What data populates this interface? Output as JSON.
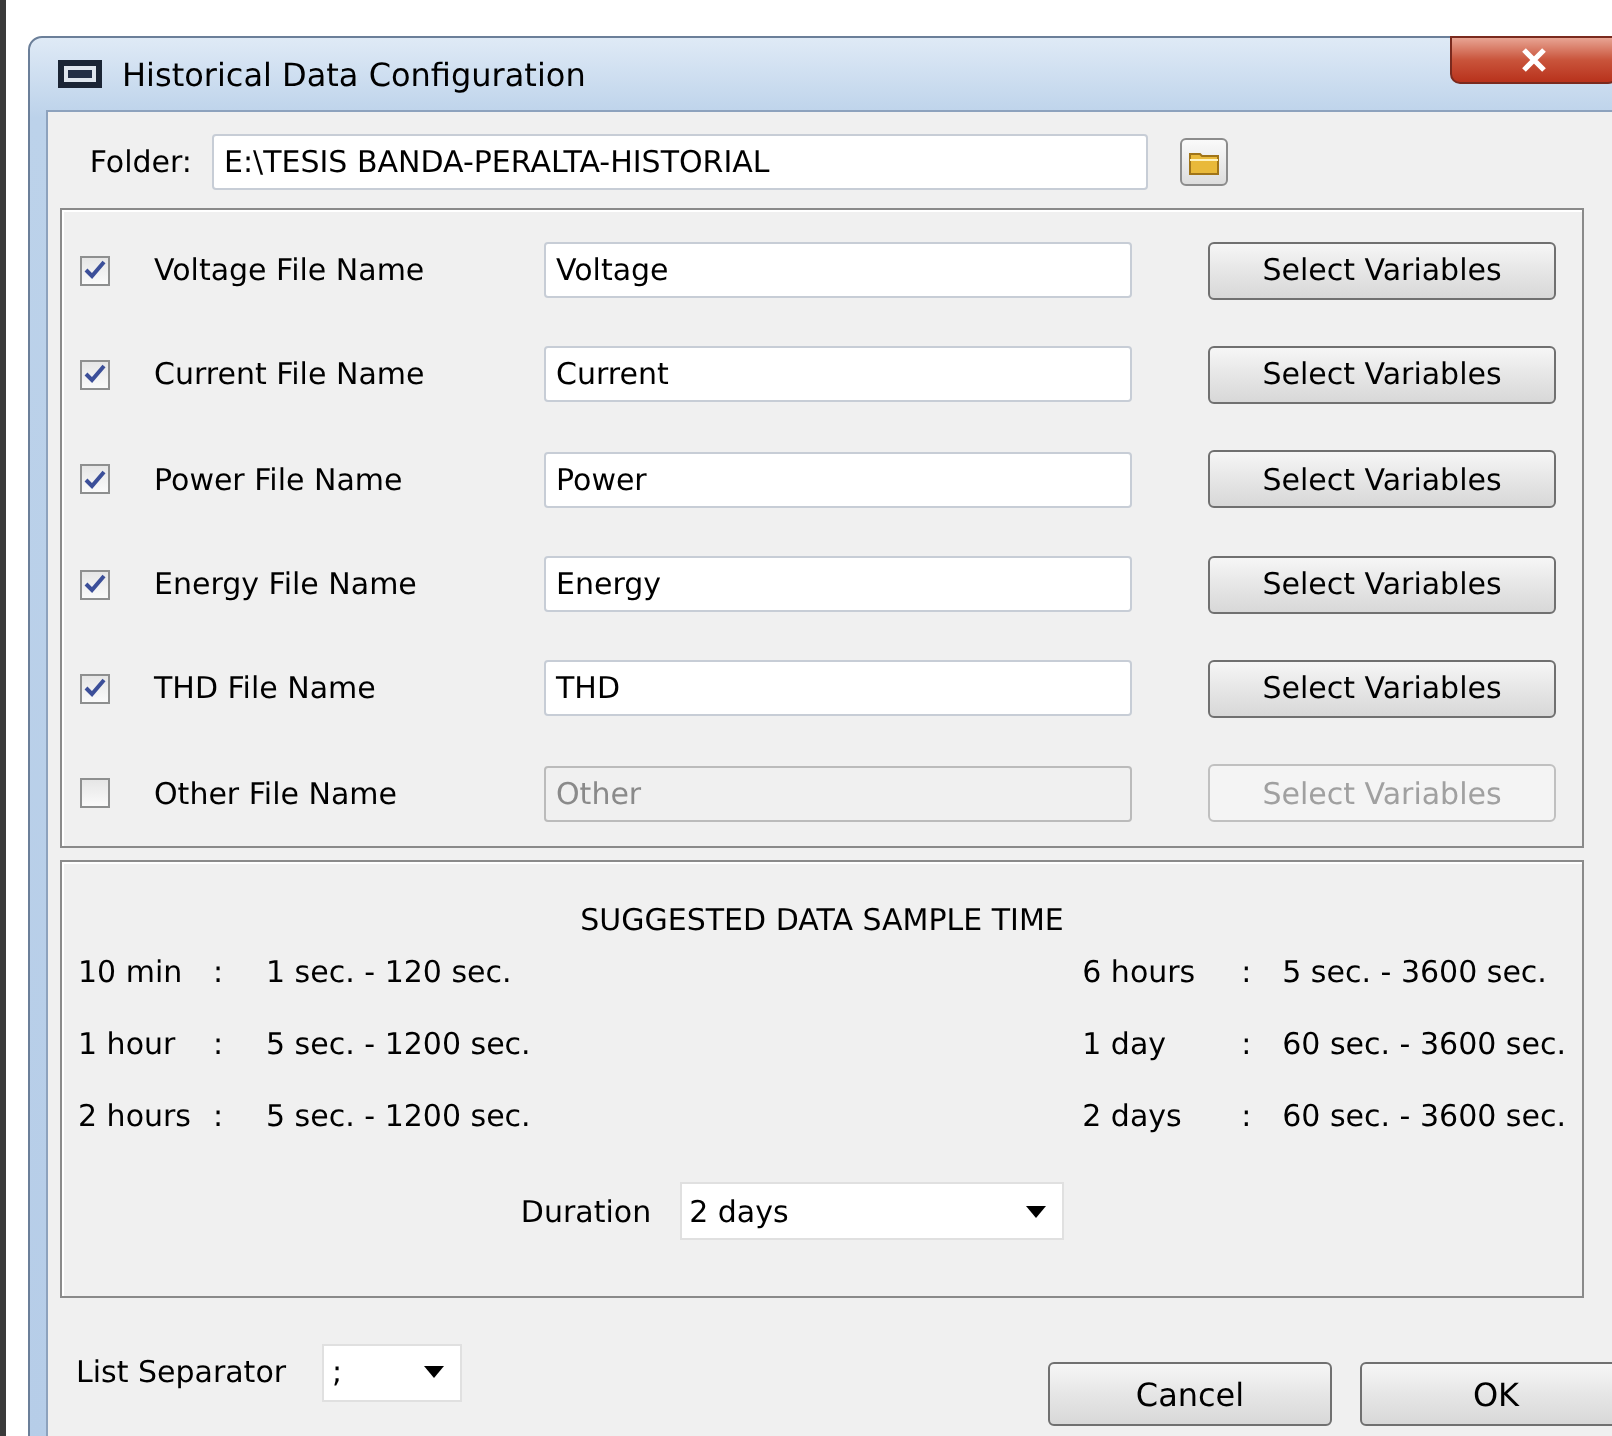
{
  "window": {
    "title": "Historical Data Configuration"
  },
  "folder": {
    "label": "Folder:",
    "value": "E:\\TESIS BANDA-PERALTA-HISTORIAL"
  },
  "files": [
    {
      "label": "Voltage File Name",
      "checked": true,
      "value": "Voltage",
      "disabled": false,
      "button": "Select Variables"
    },
    {
      "label": "Current File Name",
      "checked": true,
      "value": "Current",
      "disabled": false,
      "button": "Select Variables"
    },
    {
      "label": "Power File Name",
      "checked": true,
      "value": "Power",
      "disabled": false,
      "button": "Select Variables"
    },
    {
      "label": "Energy File Name",
      "checked": true,
      "value": "Energy",
      "disabled": false,
      "button": "Select Variables"
    },
    {
      "label": "THD File Name",
      "checked": true,
      "value": "THD",
      "disabled": false,
      "button": "Select Variables"
    },
    {
      "label": "Other File Name",
      "checked": false,
      "value": "Other",
      "disabled": true,
      "button": "Select Variables"
    }
  ],
  "sample_time": {
    "title": "SUGGESTED DATA SAMPLE TIME",
    "rows": [
      {
        "left": {
          "period": "10 min",
          "colon": ":",
          "range": "1 sec. - 120 sec."
        },
        "right": {
          "period": "6 hours",
          "colon": ":",
          "range": "5 sec. - 3600 sec."
        }
      },
      {
        "left": {
          "period": "1 hour",
          "colon": ":",
          "range": "5 sec. - 1200 sec."
        },
        "right": {
          "period": "1 day",
          "colon": ":",
          "range": "60 sec. - 3600 sec."
        }
      },
      {
        "left": {
          "period": "2 hours",
          "colon": ":",
          "range": "5 sec. - 1200 sec."
        },
        "right": {
          "period": "2 days",
          "colon": ":",
          "range": "60 sec. - 3600 sec."
        }
      }
    ],
    "duration": {
      "label": "Duration",
      "value": "2 days"
    }
  },
  "list_separator": {
    "label": "List Separator",
    "value": ";"
  },
  "buttons": [
    "Cancel",
    "OK"
  ]
}
